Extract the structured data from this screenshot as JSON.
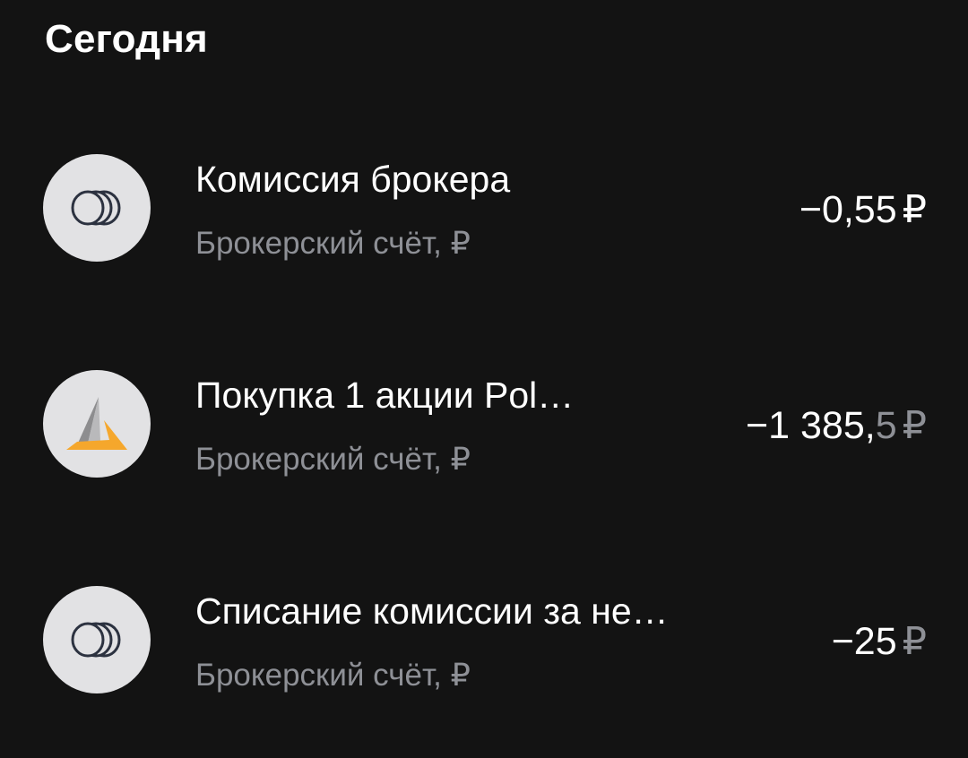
{
  "section": {
    "title": "Сегодня"
  },
  "operations": [
    {
      "title": "Комиссия брокера",
      "subtitle": "Брокерский счёт, ₽",
      "amount_main": "−0,55",
      "amount_dim": "",
      "currency": "₽",
      "icon": "coins-icon"
    },
    {
      "title": "Покупка 1 акции Pol…",
      "subtitle": "Брокерский счёт, ₽",
      "amount_main": "−1 385,",
      "amount_dim": "5",
      "currency": "₽",
      "icon": "polymetal-logo-icon"
    },
    {
      "title": "Списание комиссии за не…",
      "subtitle": "Брокерский счёт, ₽",
      "amount_main": "−25",
      "amount_dim": "",
      "currency": "₽",
      "icon": "coins-icon"
    }
  ],
  "colors": {
    "background": "#131313",
    "primary_text": "#ffffff",
    "secondary_text": "#8e9096",
    "icon_background": "#e2e2e4",
    "logo_orange": "#f5a72c",
    "logo_gray": "#8d8d8f"
  }
}
